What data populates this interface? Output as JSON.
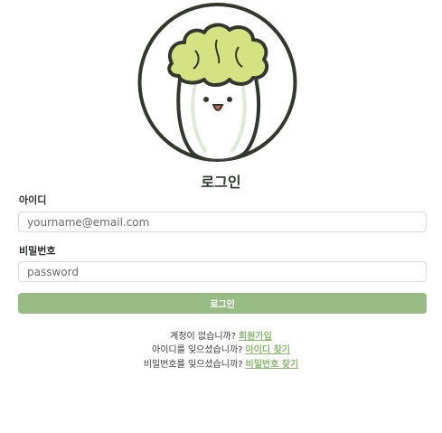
{
  "page": {
    "title": "로그인",
    "logo_icon": "cabbage-mascot-icon",
    "colors": {
      "accent": "#98bd84",
      "link": "#8cb672",
      "leaf": "#d4e281",
      "outline": "#33372f"
    }
  },
  "form": {
    "id_label": "아이디",
    "id_placeholder": "yourname@email.com",
    "password_label": "비밀번호",
    "password_placeholder": "password",
    "submit_label": "로그인"
  },
  "help": {
    "signup_text": "계정이 없습니까?",
    "signup_link": "회원가입",
    "find_id_text": "아이디를 잊으셨습니까?",
    "find_id_link": "아이디 찾기",
    "find_pw_text": "비밀번호를 잊으셨습니까?",
    "find_pw_link": "비밀번호 찾기"
  }
}
